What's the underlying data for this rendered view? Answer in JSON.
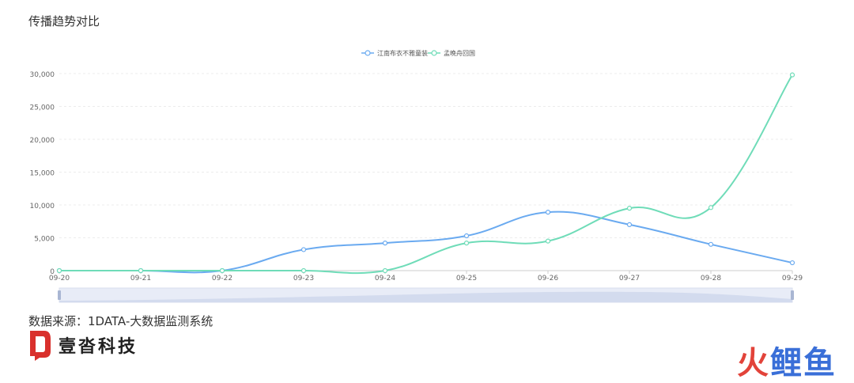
{
  "page": {
    "title": "传播趋势对比",
    "source": "数据来源：1DATA-大数据监测系统",
    "brand_name": "壹沓科技",
    "watermark": [
      "火",
      "鲤",
      "鱼"
    ]
  },
  "colors": {
    "series1": "#6aaaf0",
    "series2": "#6fdcb8",
    "axis": "#cccccc",
    "grid": "#ececec",
    "tick_text": "#666666",
    "slider_bg": "#e8ecf7",
    "slider_handle": "#a9b6d3",
    "brand_red": "#d9302c"
  },
  "chart_data": {
    "type": "line",
    "x": [
      "09-20",
      "09-21",
      "09-22",
      "09-23",
      "09-24",
      "09-25",
      "09-26",
      "09-27",
      "09-28",
      "09-29"
    ],
    "series": [
      {
        "name": "江南布衣不雅童装",
        "values": [
          0,
          0,
          0,
          3200,
          4200,
          5300,
          8900,
          7000,
          4000,
          1200
        ]
      },
      {
        "name": "孟晚舟回国",
        "values": [
          0,
          0,
          0,
          0,
          0,
          4200,
          4500,
          9500,
          9600,
          29800
        ]
      }
    ],
    "yticks": [
      "0",
      "5,000",
      "10,000",
      "15,000",
      "20,000",
      "25,000",
      "30,000"
    ],
    "ylim": [
      0,
      30000
    ],
    "grid": true,
    "legend": "top-center",
    "smooth": true,
    "data_zoom": true
  }
}
